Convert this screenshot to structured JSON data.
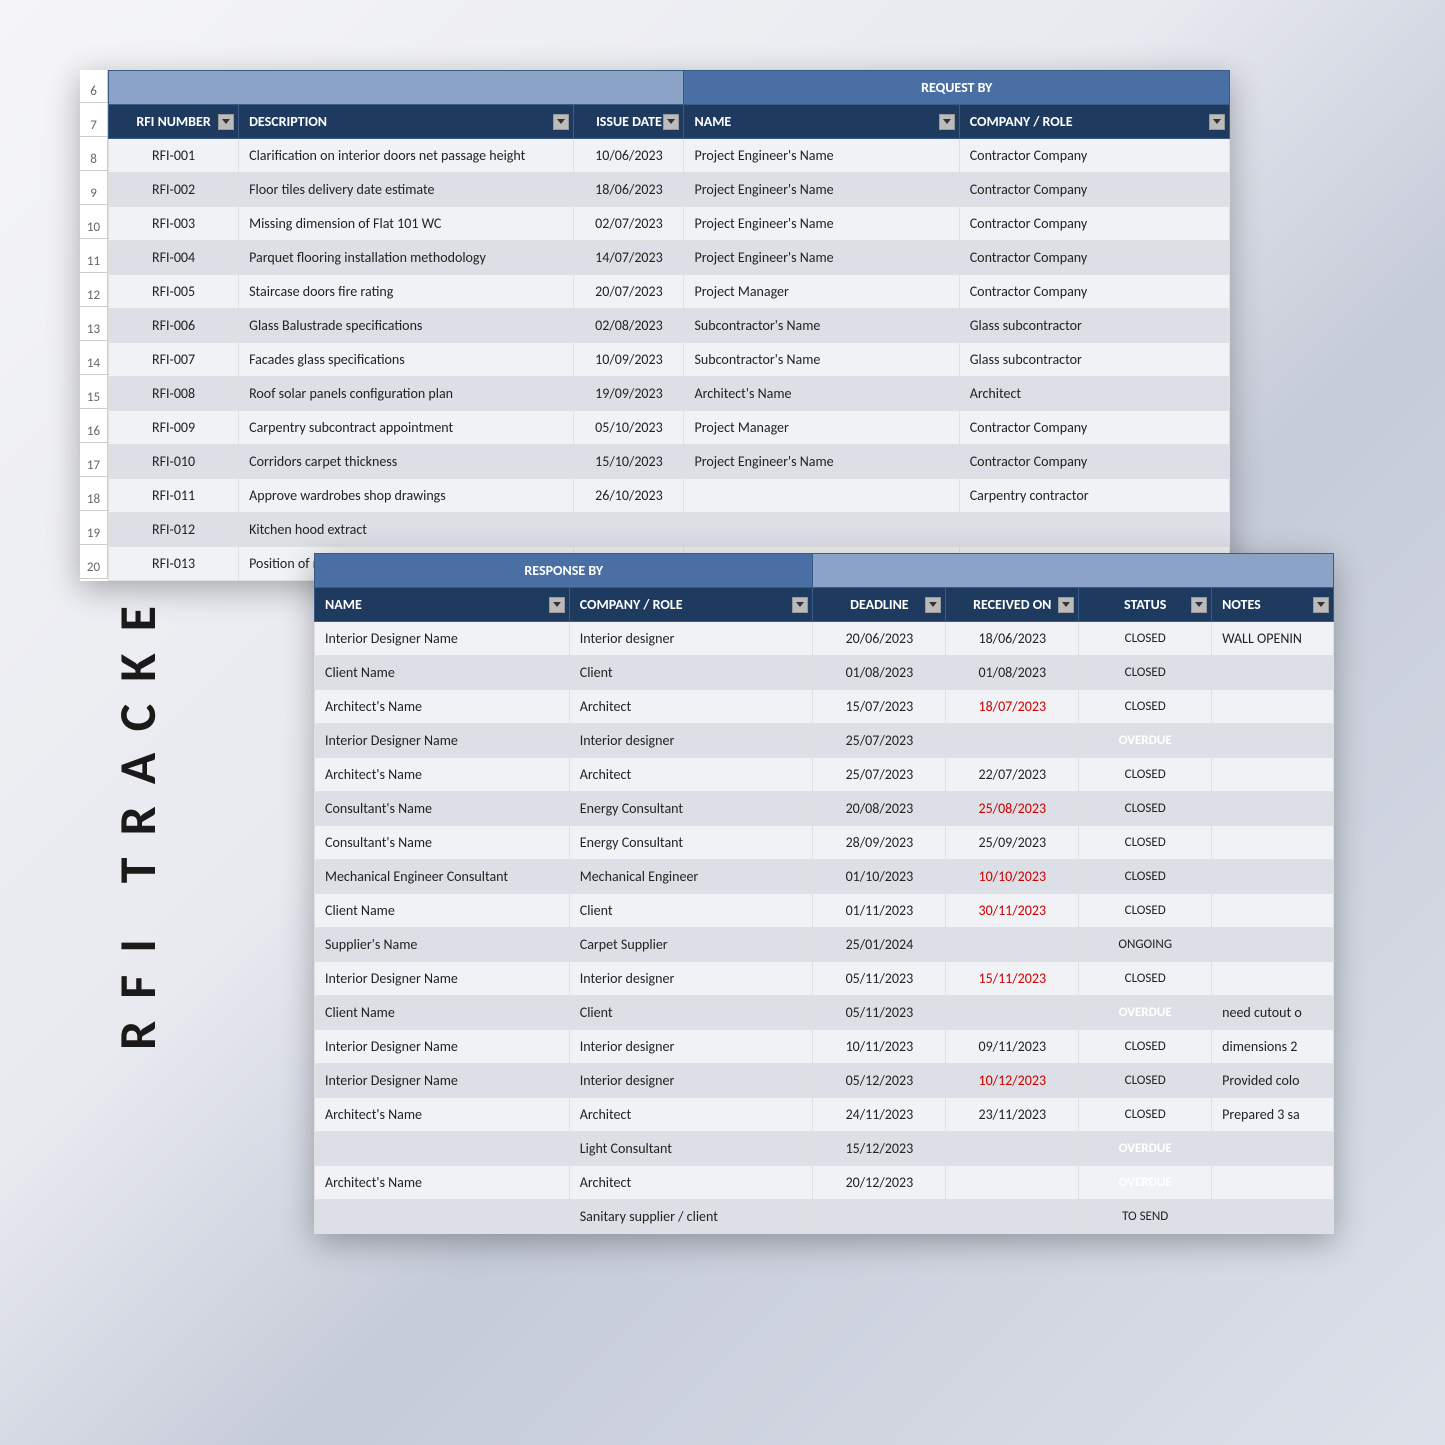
{
  "title": "RFI TRACKER",
  "topTable": {
    "rowNumbers": [
      "6",
      "7",
      "8",
      "9",
      "10",
      "11",
      "12",
      "13",
      "14",
      "15",
      "16",
      "17",
      "18",
      "19",
      "20"
    ],
    "groupHeaders": {
      "requestBy": "REQUEST BY"
    },
    "headers": [
      "RFI NUMBER",
      "DESCRIPTION",
      "ISSUE DATE",
      "NAME",
      "COMPANY / ROLE"
    ],
    "rows": [
      {
        "rfi": "RFI-001",
        "desc": "Clarification on interior doors net passage height",
        "date": "10/06/2023",
        "name": "Project Engineer's Name",
        "company": "Contractor Company"
      },
      {
        "rfi": "RFI-002",
        "desc": "Floor tiles delivery date estimate",
        "date": "18/06/2023",
        "name": "Project Engineer's Name",
        "company": "Contractor Company"
      },
      {
        "rfi": "RFI-003",
        "desc": "Missing dimension of Flat 101 WC",
        "date": "02/07/2023",
        "name": "Project Engineer's Name",
        "company": "Contractor Company"
      },
      {
        "rfi": "RFI-004",
        "desc": "Parquet flooring installation methodology",
        "date": "14/07/2023",
        "name": "Project Engineer's Name",
        "company": "Contractor Company"
      },
      {
        "rfi": "RFI-005",
        "desc": "Staircase doors fire rating",
        "date": "20/07/2023",
        "name": "Project Manager",
        "company": "Contractor Company"
      },
      {
        "rfi": "RFI-006",
        "desc": "Glass Balustrade specifications",
        "date": "02/08/2023",
        "name": "Subcontractor's Name",
        "company": "Glass subcontractor"
      },
      {
        "rfi": "RFI-007",
        "desc": "Facades glass specifications",
        "date": "10/09/2023",
        "name": "Subcontractor's Name",
        "company": "Glass subcontractor"
      },
      {
        "rfi": "RFI-008",
        "desc": "Roof solar panels configuration plan",
        "date": "19/09/2023",
        "name": "Architect's Name",
        "company": "Architect"
      },
      {
        "rfi": "RFI-009",
        "desc": "Carpentry subcontract appointment",
        "date": "05/10/2023",
        "name": "Project Manager",
        "company": "Contractor Company"
      },
      {
        "rfi": "RFI-010",
        "desc": "Corridors carpet thickness",
        "date": "15/10/2023",
        "name": "Project Engineer's Name",
        "company": "Contractor Company"
      },
      {
        "rfi": "RFI-011",
        "desc": "Approve wardrobes shop drawings",
        "date": "26/10/2023",
        "name": "",
        "company": "Carpentry contractor"
      },
      {
        "rfi": "RFI-012",
        "desc": "Kitchen hood extract",
        "date": "",
        "name": "",
        "company": ""
      },
      {
        "rfi": "RFI-013",
        "desc": "Position of main auto",
        "date": "",
        "name": "",
        "company": ""
      }
    ]
  },
  "botTable": {
    "groupHeaders": {
      "responseBy": "RESPONSE BY"
    },
    "headers": [
      "NAME",
      "COMPANY / ROLE",
      "DEADLINE",
      "RECEIVED ON",
      "STATUS",
      "NOTES"
    ],
    "rows": [
      {
        "name": "Interior Designer Name",
        "company": "Interior designer",
        "deadline": "20/06/2023",
        "received": "18/06/2023",
        "recLate": false,
        "status": "CLOSED",
        "notes": "WALL OPENIN"
      },
      {
        "name": "Client Name",
        "company": "Client",
        "deadline": "01/08/2023",
        "received": "01/08/2023",
        "recLate": false,
        "status": "CLOSED",
        "notes": ""
      },
      {
        "name": "Architect's Name",
        "company": "Architect",
        "deadline": "15/07/2023",
        "received": "18/07/2023",
        "recLate": true,
        "status": "CLOSED",
        "notes": ""
      },
      {
        "name": "Interior Designer Name",
        "company": "Interior designer",
        "deadline": "25/07/2023",
        "received": "",
        "recLate": false,
        "status": "OVERDUE",
        "notes": ""
      },
      {
        "name": "Architect's Name",
        "company": "Architect",
        "deadline": "25/07/2023",
        "received": "22/07/2023",
        "recLate": false,
        "status": "CLOSED",
        "notes": ""
      },
      {
        "name": "Consultant's Name",
        "company": "Energy Consultant",
        "deadline": "20/08/2023",
        "received": "25/08/2023",
        "recLate": true,
        "status": "CLOSED",
        "notes": ""
      },
      {
        "name": "Consultant's Name",
        "company": "Energy Consultant",
        "deadline": "28/09/2023",
        "received": "25/09/2023",
        "recLate": false,
        "status": "CLOSED",
        "notes": ""
      },
      {
        "name": "Mechanical Engineer Consultant",
        "company": "Mechanical Engineer",
        "deadline": "01/10/2023",
        "received": "10/10/2023",
        "recLate": true,
        "status": "CLOSED",
        "notes": ""
      },
      {
        "name": "Client Name",
        "company": "Client",
        "deadline": "01/11/2023",
        "received": "30/11/2023",
        "recLate": true,
        "status": "CLOSED",
        "notes": ""
      },
      {
        "name": "Supplier's Name",
        "company": "Carpet Supplier",
        "deadline": "25/01/2024",
        "received": "",
        "recLate": false,
        "status": "ONGOING",
        "notes": ""
      },
      {
        "name": "Interior Designer Name",
        "company": "Interior designer",
        "deadline": "05/11/2023",
        "received": "15/11/2023",
        "recLate": true,
        "status": "CLOSED",
        "notes": ""
      },
      {
        "name": "Client Name",
        "company": "Client",
        "deadline": "05/11/2023",
        "received": "",
        "recLate": false,
        "status": "OVERDUE",
        "notes": "need cutout o"
      },
      {
        "name": "Interior Designer Name",
        "company": "Interior designer",
        "deadline": "10/11/2023",
        "received": "09/11/2023",
        "recLate": false,
        "status": "CLOSED",
        "notes": "dimensions 2"
      },
      {
        "name": "Interior Designer Name",
        "company": "Interior designer",
        "deadline": "05/12/2023",
        "received": "10/12/2023",
        "recLate": true,
        "status": "CLOSED",
        "notes": "Provided colo"
      },
      {
        "name": "Architect's Name",
        "company": "Architect",
        "deadline": "24/11/2023",
        "received": "23/11/2023",
        "recLate": false,
        "status": "CLOSED",
        "notes": "Prepared 3 sa"
      },
      {
        "name": "",
        "company": "Light Consultant",
        "deadline": "15/12/2023",
        "received": "",
        "recLate": false,
        "status": "OVERDUE",
        "notes": ""
      },
      {
        "name": "Architect's Name",
        "company": "Architect",
        "deadline": "20/12/2023",
        "received": "",
        "recLate": false,
        "status": "OVERDUE",
        "notes": ""
      },
      {
        "name": "",
        "company": "Sanitary supplier / client",
        "deadline": "",
        "received": "",
        "recLate": false,
        "status": "TO SEND",
        "notes": ""
      }
    ]
  }
}
